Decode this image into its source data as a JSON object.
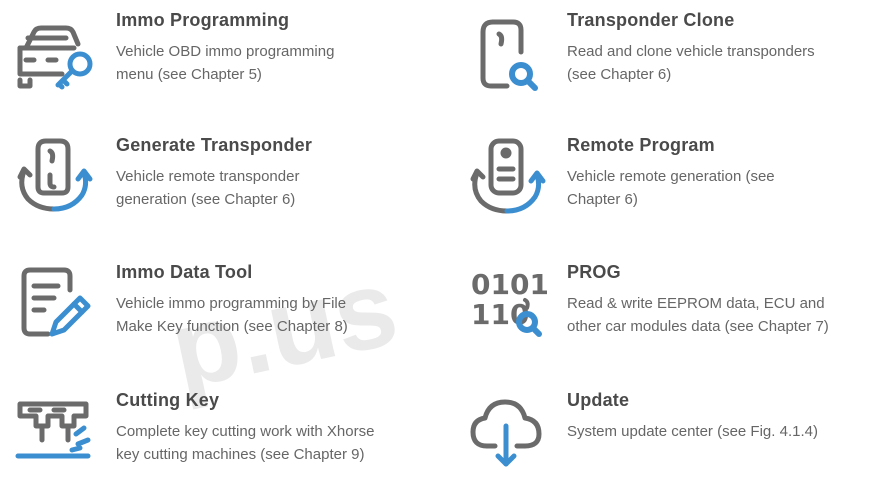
{
  "accent_color": "#3b8ed0",
  "icon_color": "#6b6b6b",
  "watermark": {
    "text": "p.us"
  },
  "items": [
    {
      "title": "Immo Programming",
      "desc_lines": [
        "Vehicle OBD immo programming",
        "menu (see Chapter 5)"
      ],
      "icon": "car-key-icon"
    },
    {
      "title": "Transponder Clone",
      "desc_lines": [
        "Read and clone vehicle transponders",
        "(see Chapter 6)"
      ],
      "icon": "transponder-search-icon"
    },
    {
      "title": "Generate Transponder",
      "desc_lines": [
        "Vehicle remote transponder",
        "generation (see Chapter 6)"
      ],
      "icon": "transponder-cycle-icon"
    },
    {
      "title": "Remote Program",
      "desc_lines": [
        "Vehicle remote generation (see",
        "Chapter 6)"
      ],
      "icon": "remote-cycle-icon"
    },
    {
      "title": "Immo Data Tool",
      "desc_lines": [
        "Vehicle immo programming by File",
        "Make Key function (see Chapter 8)"
      ],
      "icon": "document-edit-icon"
    },
    {
      "title": "PROG",
      "desc_lines": [
        "Read & write EEPROM data, ECU and",
        "other car modules data (see Chapter 7)"
      ],
      "icon": "binary-search-icon",
      "icon_text": [
        "0101",
        "110"
      ]
    },
    {
      "title": "Cutting Key",
      "desc_lines": [
        "Complete key cutting work with Xhorse",
        "key cutting machines (see Chapter 9)"
      ],
      "icon": "key-cutter-icon"
    },
    {
      "title": "Update",
      "desc_lines": [
        "System update center (see Fig. 4.1.4)"
      ],
      "icon": "cloud-download-icon"
    }
  ]
}
